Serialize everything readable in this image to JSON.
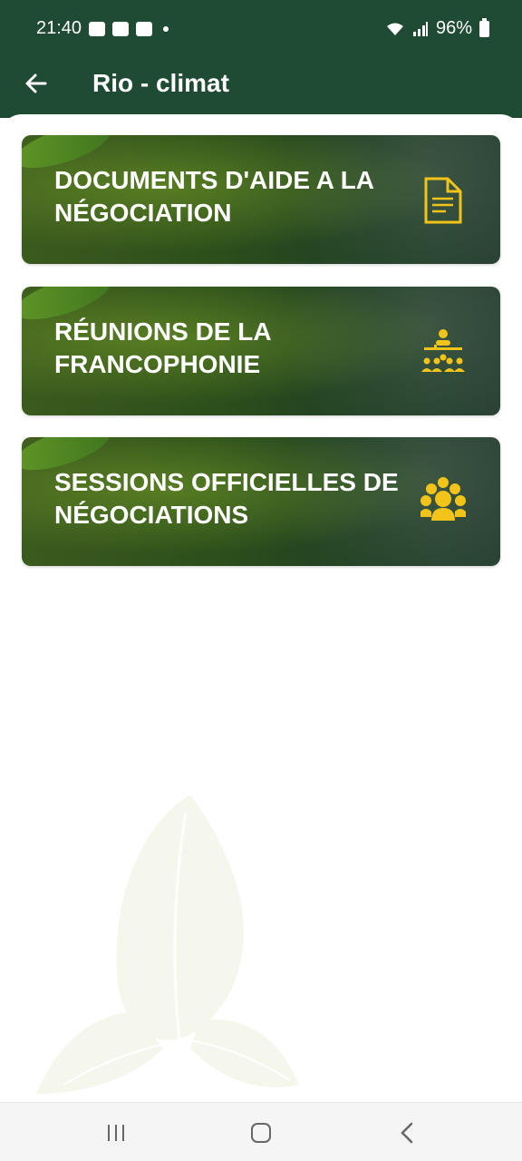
{
  "status_bar": {
    "time": "21:40",
    "battery": "96%"
  },
  "app_bar": {
    "title": "Rio - climat"
  },
  "cards": [
    {
      "label": "DOCUMENTS D'AIDE A LA NÉGOCIATION",
      "icon": "document-icon"
    },
    {
      "label": "RÉUNIONS DE LA FRANCOPHONIE",
      "icon": "meeting-icon"
    },
    {
      "label": "SESSIONS OFFICIELLES DE NÉGOCIATIONS",
      "icon": "group-icon"
    }
  ],
  "colors": {
    "header": "#1f4a33",
    "accent": "#f2c318"
  }
}
